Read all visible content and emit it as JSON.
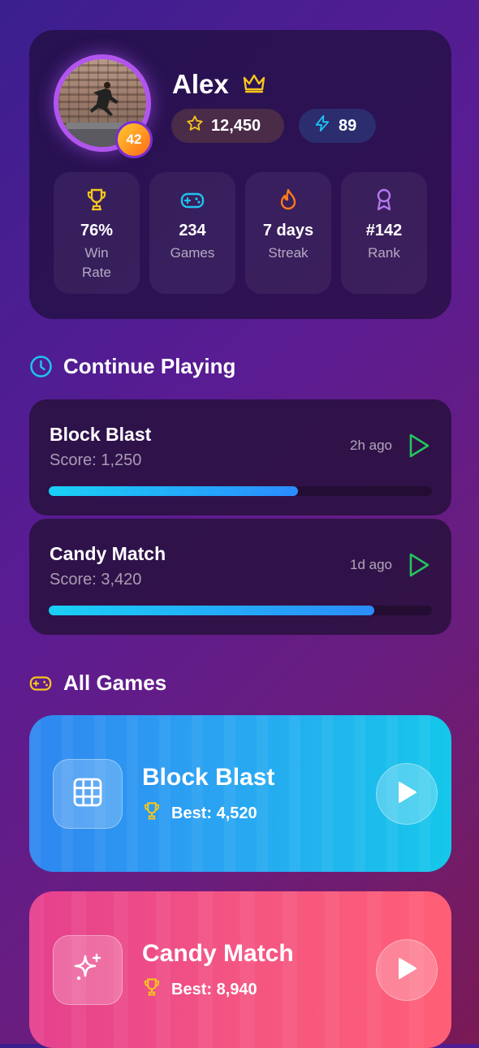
{
  "profile": {
    "name": "Alex",
    "level": "42",
    "coins": "12,450",
    "energy": "89",
    "stats": [
      {
        "value": "76%",
        "label": "Win Rate",
        "icon": "trophy-icon"
      },
      {
        "value": "234",
        "label": "Games",
        "icon": "gamepad-icon"
      },
      {
        "value": "7 days",
        "label": "Streak",
        "icon": "flame-icon"
      },
      {
        "value": "#142",
        "label": "Rank",
        "icon": "medal-icon"
      }
    ]
  },
  "continue_playing": {
    "title": "Continue Playing",
    "items": [
      {
        "name": "Block Blast",
        "score": "Score: 1,250",
        "time": "2h ago",
        "progress": 0.65
      },
      {
        "name": "Candy Match",
        "score": "Score: 3,420",
        "time": "1d ago",
        "progress": 0.85
      }
    ]
  },
  "all_games": {
    "title": "All Games",
    "items": [
      {
        "name": "Block Blast",
        "best": "Best: 4,520",
        "icon": "grid-icon",
        "color": "#2a9cf2"
      },
      {
        "name": "Candy Match",
        "best": "Best: 8,940",
        "icon": "sparkles-icon",
        "color": "#f04f85"
      }
    ]
  },
  "colors": {
    "accent_gold": "#f7c51e",
    "accent_cyan": "#1fc3f0",
    "play_green": "#22c55e"
  }
}
